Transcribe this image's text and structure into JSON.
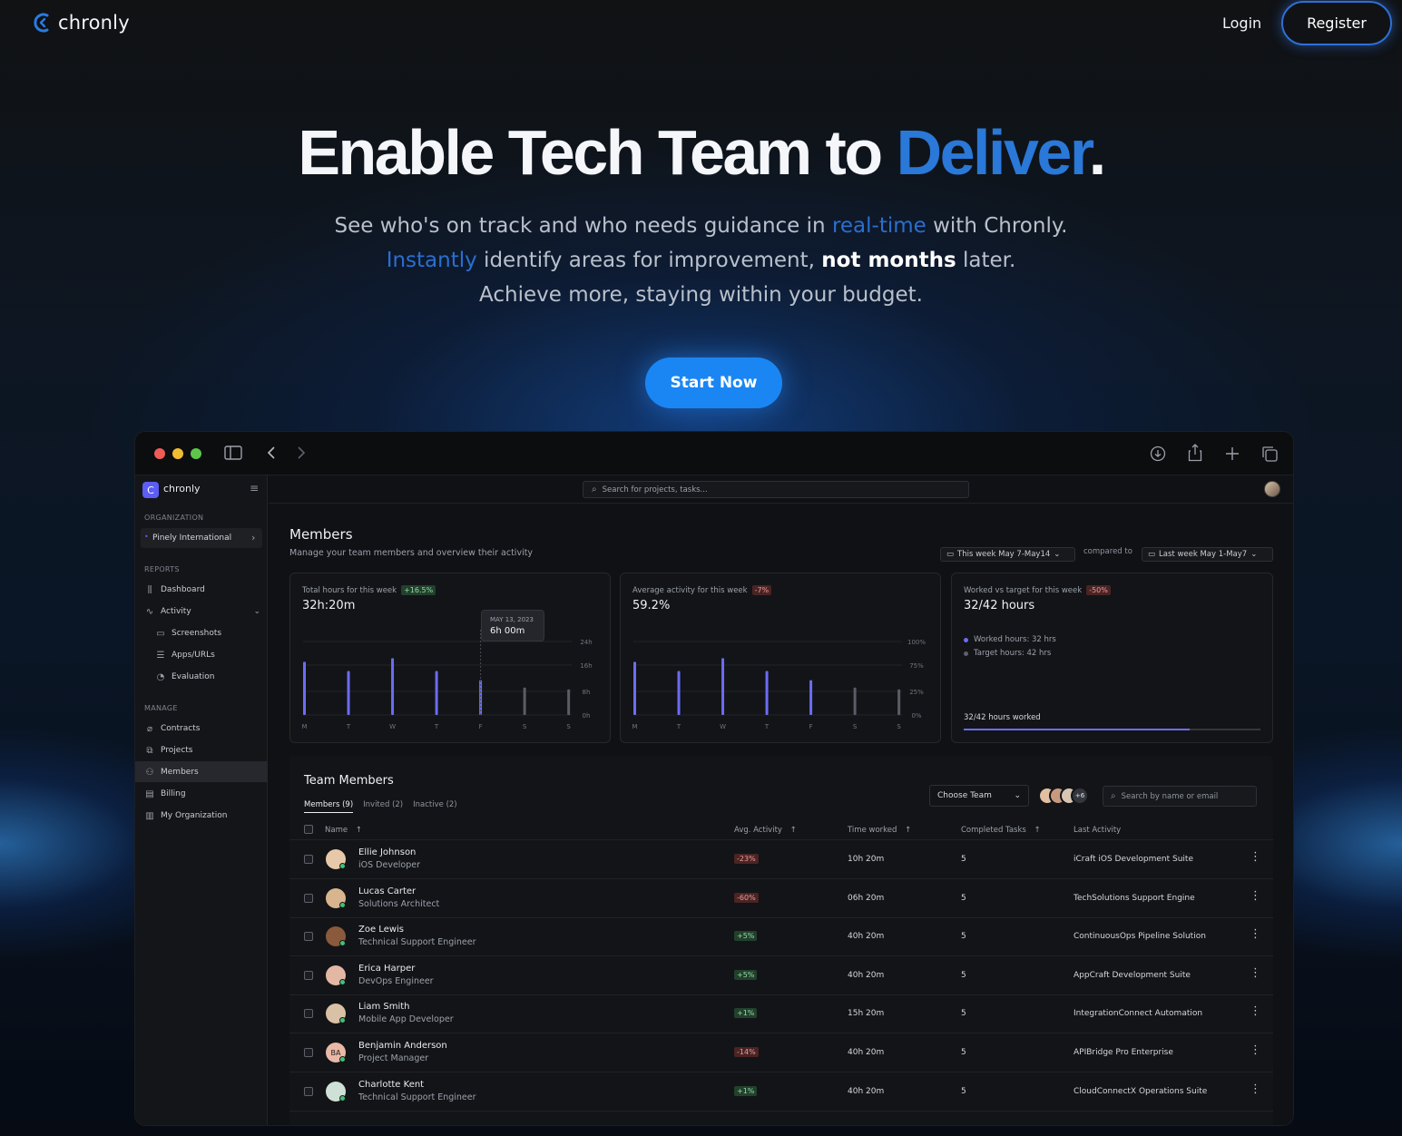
{
  "nav": {
    "brand": "chronly",
    "login": "Login",
    "register": "Register"
  },
  "hero": {
    "title_main": "Enable Tech Team to ",
    "title_accent": "Deliver",
    "title_end": ".",
    "line1_a": "See who's on track and who needs guidance in ",
    "line1_hl": "real-time",
    "line1_b": " with Chronly.",
    "line2_hl": "Instantly",
    "line2_a": " identify areas for improvement, ",
    "line2_bold": "not months",
    "line2_b": " later.",
    "line3": "Achieve more, staying within your budget.",
    "cta": "Start Now"
  },
  "app": {
    "sidebar": {
      "brand": "chronly",
      "org_section": "ORGANIZATION",
      "org_name": "Pinely International",
      "reports_section": "REPORTS",
      "manage_section": "MANAGE",
      "reports": [
        {
          "label": "Dashboard",
          "icon": "chart-icon"
        },
        {
          "label": "Activity",
          "icon": "activity-icon"
        },
        {
          "label": "Screenshots",
          "icon": "screenshot-icon"
        },
        {
          "label": "Apps/URLs",
          "icon": "list-icon"
        },
        {
          "label": "Evaluation",
          "icon": "pie-icon"
        }
      ],
      "manage": [
        {
          "label": "Contracts",
          "icon": "paperclip-icon"
        },
        {
          "label": "Projects",
          "icon": "copy-icon"
        },
        {
          "label": "Members",
          "icon": "users-icon"
        },
        {
          "label": "Billing",
          "icon": "card-icon"
        },
        {
          "label": "My Organization",
          "icon": "building-icon"
        }
      ]
    },
    "search_placeholder": "Search for projects, tasks...",
    "page": {
      "title": "Members",
      "subtitle": "Manage your team members and overview their activity",
      "period": "This week May 7-May14",
      "compared": "compared to",
      "prev_period": "Last week May 1-May7"
    },
    "cards": [
      {
        "label": "Total hours for this week",
        "delta": "+16.5%",
        "value": "32h:20m",
        "tooltip_date": "MAY 13, 2023",
        "tooltip_value": "6h 00m",
        "y_ticks": [
          "24h",
          "16h",
          "8h",
          "0h"
        ],
        "days": [
          "M",
          "T",
          "W",
          "T",
          "F",
          "S",
          "S"
        ],
        "bars": [
          0.58,
          0.48,
          0.62,
          0.48,
          0.38,
          0.3,
          0.28
        ]
      },
      {
        "label": "Average activity for this week",
        "delta": "-7%",
        "value": "59.2%",
        "y_ticks": [
          "100%",
          "75%",
          "25%",
          "0%"
        ],
        "days": [
          "M",
          "T",
          "W",
          "T",
          "F",
          "S",
          "S"
        ],
        "bars": [
          0.58,
          0.48,
          0.62,
          0.48,
          0.38,
          0.3,
          0.28
        ]
      },
      {
        "label": "Worked vs target for this week",
        "delta": "-50%",
        "value": "32/42 hours",
        "legend_worked": "Worked hours: 32 hrs",
        "legend_target": "Target hours: 42 hrs",
        "progress_label": "32/42 hours worked",
        "progress": 0.762
      }
    ],
    "team": {
      "title": "Team Members",
      "tabs": [
        "Members (9)",
        "Invited (2)",
        "Inactive (2)"
      ],
      "choose_team": "Choose Team",
      "more_count": "+6",
      "search_placeholder": "Search by name or email",
      "headers": [
        "Name",
        "Avg. Activity",
        "Time worked",
        "Completed Tasks",
        "Last Activity"
      ],
      "rows": [
        {
          "name": "Ellie Johnson",
          "role": "iOS Developer",
          "activity": "-23%",
          "time": "10h 20m",
          "tasks": "5",
          "last": "iCraft iOS Development Suite",
          "initials": "",
          "color": "#e7c9a9"
        },
        {
          "name": "Lucas Carter",
          "role": "Solutions Architect",
          "activity": "-60%",
          "time": "06h 20m",
          "tasks": "5",
          "last": "TechSolutions Support Engine",
          "initials": "",
          "color": "#d8b58e"
        },
        {
          "name": "Zoe Lewis",
          "role": "Technical Support Engineer",
          "activity": "+5%",
          "time": "40h 20m",
          "tasks": "5",
          "last": "ContinuousOps Pipeline Solution",
          "initials": "",
          "color": "#8a5a3c"
        },
        {
          "name": "Erica Harper",
          "role": "DevOps Engineer",
          "activity": "+5%",
          "time": "40h 20m",
          "tasks": "5",
          "last": "AppCraft Development Suite",
          "initials": "",
          "color": "#e3b7a4"
        },
        {
          "name": "Liam Smith",
          "role": "Mobile App Developer",
          "activity": "+1%",
          "time": "15h 20m",
          "tasks": "5",
          "last": "IntegrationConnect Automation",
          "initials": "",
          "color": "#d9c1a6"
        },
        {
          "name": "Benjamin Anderson",
          "role": "Project Manager",
          "activity": "-14%",
          "time": "40h 20m",
          "tasks": "5",
          "last": "APIBridge Pro Enterprise",
          "initials": "BA",
          "color": "#e9b8a6"
        },
        {
          "name": "Charlotte Kent",
          "role": "Technical Support Engineer",
          "activity": "+1%",
          "time": "40h 20m",
          "tasks": "5",
          "last": "CloudConnectX Operations Suite",
          "initials": "",
          "color": "#cfe0d6"
        }
      ]
    }
  }
}
